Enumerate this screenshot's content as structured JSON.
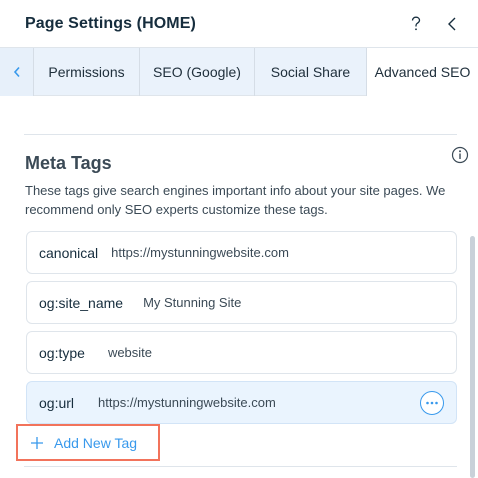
{
  "header": {
    "title": "Page Settings (HOME)",
    "help_icon": "question-icon",
    "collapse_icon": "chevron-left-icon"
  },
  "tabs": {
    "scroll_icon": "chevron-left-icon",
    "items": [
      {
        "label": "Permissions",
        "active": false
      },
      {
        "label": "SEO (Google)",
        "active": false
      },
      {
        "label": "Social Share",
        "active": false
      },
      {
        "label": "Advanced SEO",
        "active": true
      }
    ]
  },
  "meta": {
    "title": "Meta Tags",
    "info_icon": "info-icon",
    "description": "These tags give search engines important info about your site pages. We recommend only SEO experts customize these tags.",
    "tags": [
      {
        "name": "canonical",
        "value": "https://mystunningwebsite.com"
      },
      {
        "name": "og:site_name",
        "value": "My Stunning Site"
      },
      {
        "name": "og:type",
        "value": "website"
      },
      {
        "name": "og:url",
        "value": "https://mystunningwebsite.com",
        "hovered": true,
        "more_icon": "more-icon"
      }
    ],
    "add_label": "Add New Tag",
    "add_icon": "plus-icon"
  },
  "colors": {
    "accent": "#3899ec",
    "highlight_outline": "#f2735b",
    "tab_bar": "#eaf2fb",
    "hover_row": "#eaf4fe"
  }
}
